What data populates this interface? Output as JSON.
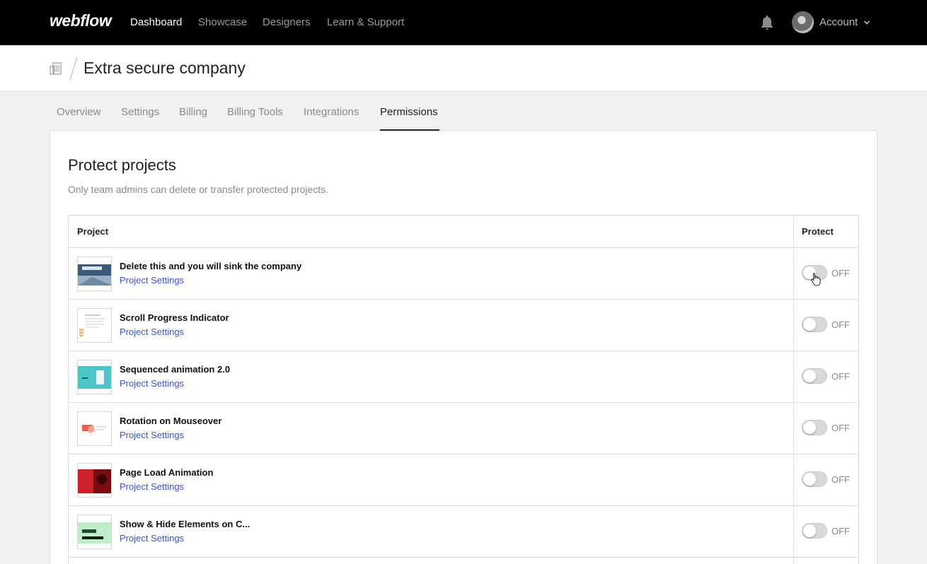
{
  "nav": {
    "logo": "webflow",
    "links": [
      "Dashboard",
      "Showcase",
      "Designers",
      "Learn & Support"
    ],
    "active_index": 0,
    "account_label": "Account",
    "icons": [
      "bell-icon",
      "avatar",
      "chevron-down-icon"
    ]
  },
  "header": {
    "company_name": "Extra secure company",
    "icon": "building-icon"
  },
  "tabs": {
    "items": [
      "Overview",
      "Settings",
      "Billing",
      "Billing Tools",
      "Integrations",
      "Permissions"
    ],
    "active": "Permissions"
  },
  "card": {
    "title": "Protect projects",
    "subtitle": "Only team admins can delete or transfer protected projects."
  },
  "table": {
    "headers": {
      "project": "Project",
      "protect": "Protect"
    },
    "rows": [
      {
        "name": "Delete this and you will sink the company",
        "link": "Project Settings",
        "state": "OFF",
        "protected": false
      },
      {
        "name": "Scroll Progress Indicator",
        "link": "Project Settings",
        "state": "OFF",
        "protected": false
      },
      {
        "name": "Sequenced animation 2.0",
        "link": "Project Settings",
        "state": "OFF",
        "protected": false
      },
      {
        "name": "Rotation on Mouseover",
        "link": "Project Settings",
        "state": "OFF",
        "protected": false
      },
      {
        "name": "Page Load Animation",
        "link": "Project Settings",
        "state": "OFF",
        "protected": false
      },
      {
        "name": "Show & Hide Elements on C...",
        "link": "Project Settings",
        "state": "OFF",
        "protected": false
      }
    ]
  },
  "colors": {
    "nav_bg": "#000000",
    "link_blue": "#3a55c4",
    "page_bg": "#f1f1f1"
  }
}
